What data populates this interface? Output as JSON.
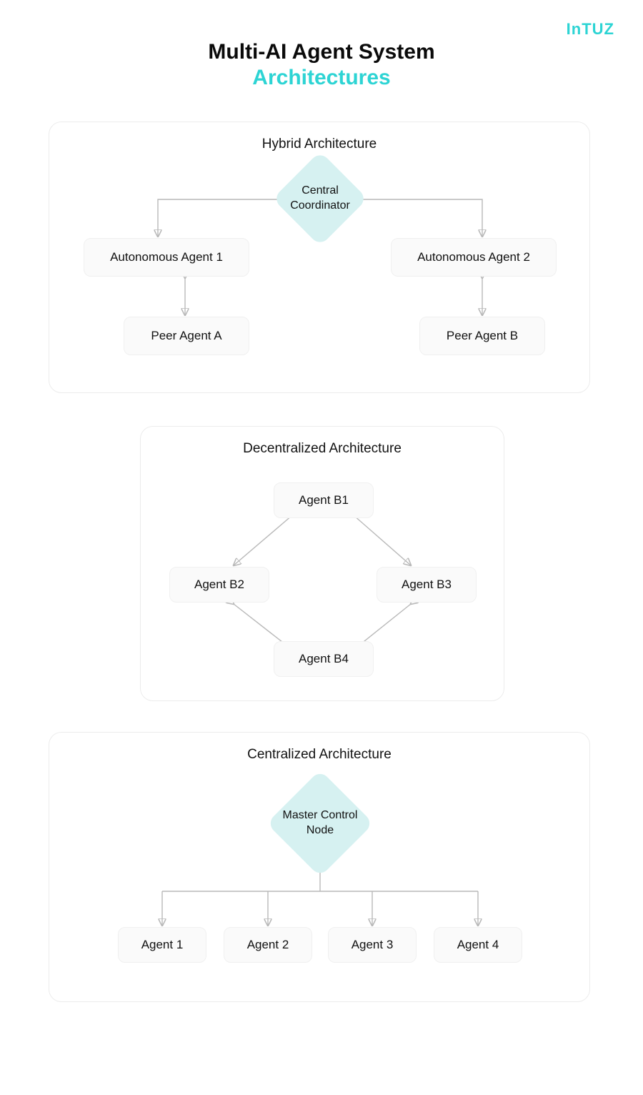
{
  "brand": "InTUZ",
  "title": {
    "line1": "Multi-AI Agent System",
    "line2": "Architectures"
  },
  "hybrid": {
    "title": "Hybrid Architecture",
    "coordinator": "Central Coordinator",
    "autonomous1": "Autonomous Agent 1",
    "autonomous2": "Autonomous Agent 2",
    "peerA": "Peer Agent A",
    "peerB": "Peer Agent B"
  },
  "decentralized": {
    "title": "Decentralized Architecture",
    "b1": "Agent B1",
    "b2": "Agent B2",
    "b3": "Agent B3",
    "b4": "Agent B4"
  },
  "centralized": {
    "title": "Centralized Architecture",
    "master": "Master Control Node",
    "a1": "Agent 1",
    "a2": "Agent 2",
    "a3": "Agent 3",
    "a4": "Agent 4"
  }
}
